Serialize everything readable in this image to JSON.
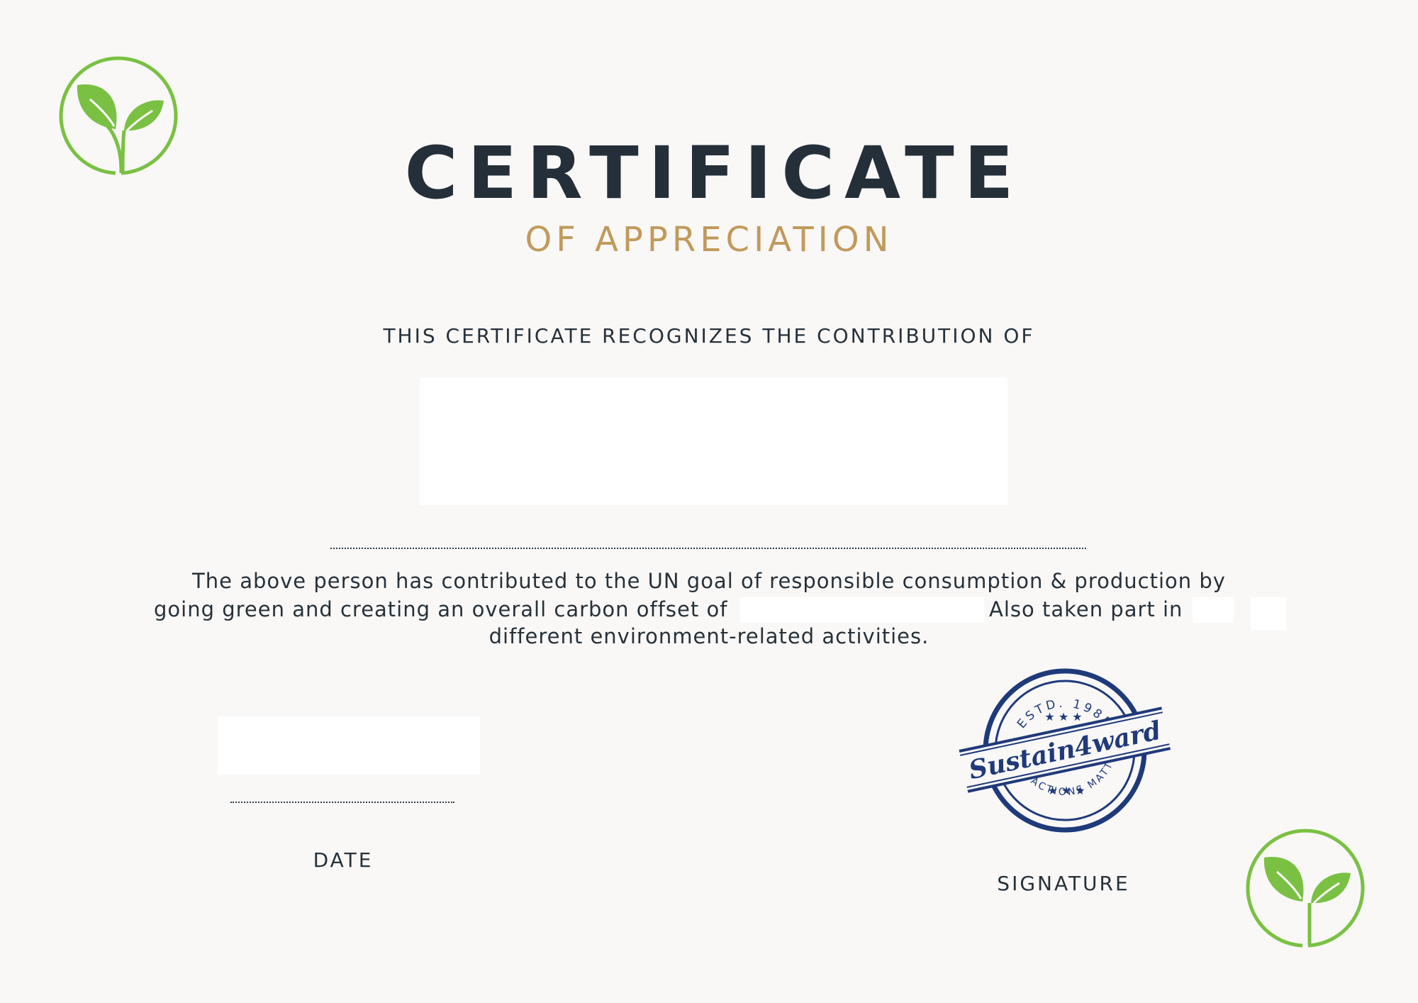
{
  "certificate": {
    "title": "CERTIFICATE",
    "subtitle": "OF APPRECIATION",
    "recognizes_text": "THIS CERTIFICATE RECOGNIZES THE CONTRIBUTION OF",
    "body_line_1": "The above person has contributed to the UN goal of responsible consumption & production by",
    "body_line_2a": "going green and creating an overall carbon offset of",
    "body_line_2b": "Also taken part in",
    "body_line_3": "different environment-related activities.",
    "date_label": "DATE",
    "signature_label": "SIGNATURE"
  },
  "stamp": {
    "top_text": "ESTD. 1985",
    "brand": "Sustain4ward",
    "bottom_text": "YOUR ACTIONS MATTER",
    "color": "#1f3a7a"
  },
  "logos": {
    "icon": "leaf-sprout-icon",
    "color": "#7ac143"
  },
  "colors": {
    "title": "#242f39",
    "subtitle": "#c19a5b",
    "background": "#f9f8f7"
  }
}
